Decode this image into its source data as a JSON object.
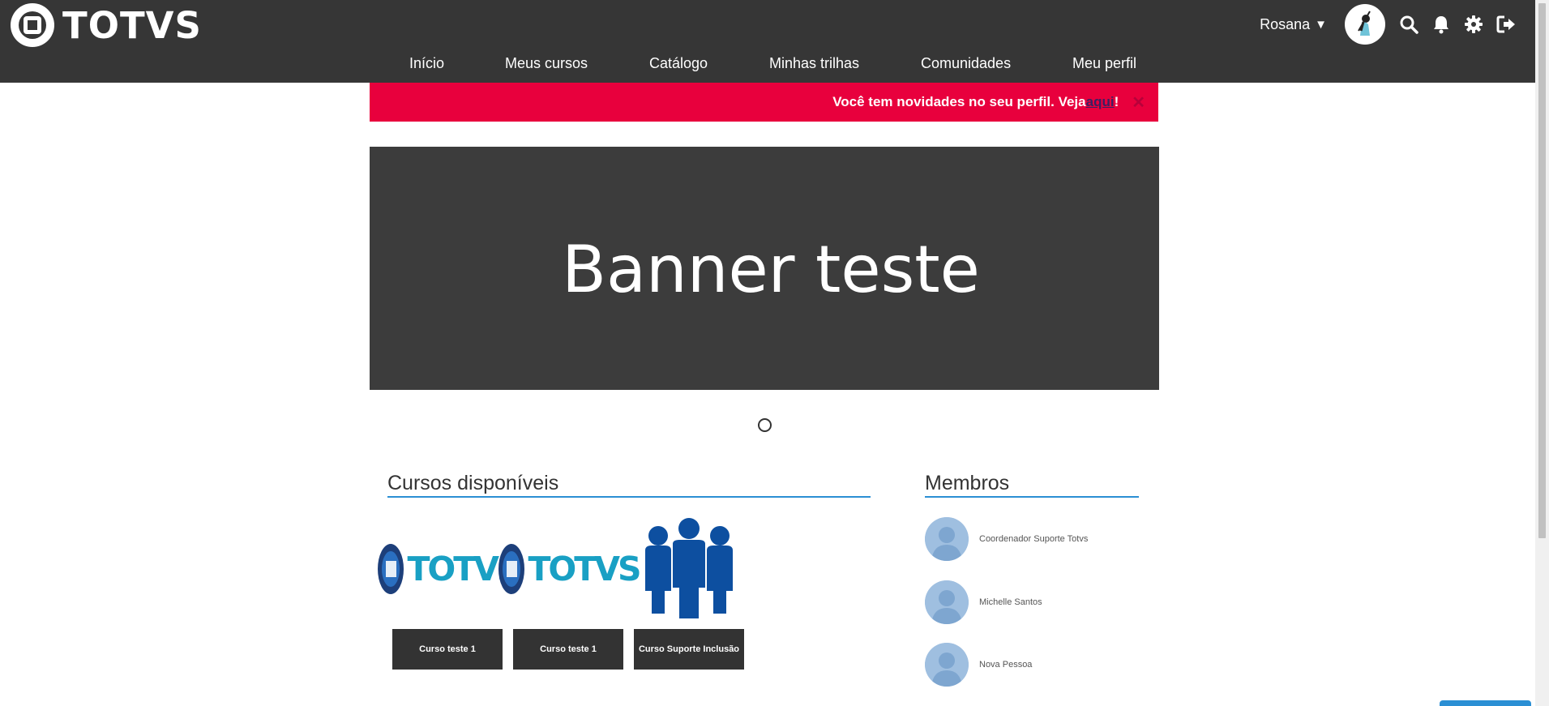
{
  "brand": {
    "name": "TOTVS"
  },
  "user": {
    "name": "Rosana",
    "caret": "▼"
  },
  "header_icons": [
    "search-icon",
    "bell-icon",
    "gear-icon",
    "logout-icon"
  ],
  "nav": {
    "items": [
      {
        "label": "Início"
      },
      {
        "label": "Meus cursos"
      },
      {
        "label": "Catálogo"
      },
      {
        "label": "Minhas trilhas"
      },
      {
        "label": "Comunidades"
      },
      {
        "label": "Meu perfil"
      }
    ]
  },
  "alert": {
    "text": "Você tem novidades no seu perfil. Veja ",
    "link": "aqui",
    "suffix": "!",
    "close": "✕",
    "color": "#e8003d"
  },
  "banner": {
    "text": "Banner teste",
    "slides": 1
  },
  "courses": {
    "title": "Cursos disponíveis",
    "items": [
      {
        "label": "Curso teste 1",
        "thumb": "totvs-logo"
      },
      {
        "label": "Curso teste 1",
        "thumb": "totvs-logo"
      },
      {
        "label": "Curso Suporte Inclusão",
        "thumb": "people-icon"
      }
    ]
  },
  "members": {
    "title": "Membros",
    "items": [
      {
        "name": "Coordenador Suporte Totvs"
      },
      {
        "name": "Michelle Santos"
      },
      {
        "name": "Nova Pessoa"
      }
    ]
  },
  "colors": {
    "topbar": "#363636",
    "accent": "#2b8fd4",
    "alert": "#e8003d"
  }
}
